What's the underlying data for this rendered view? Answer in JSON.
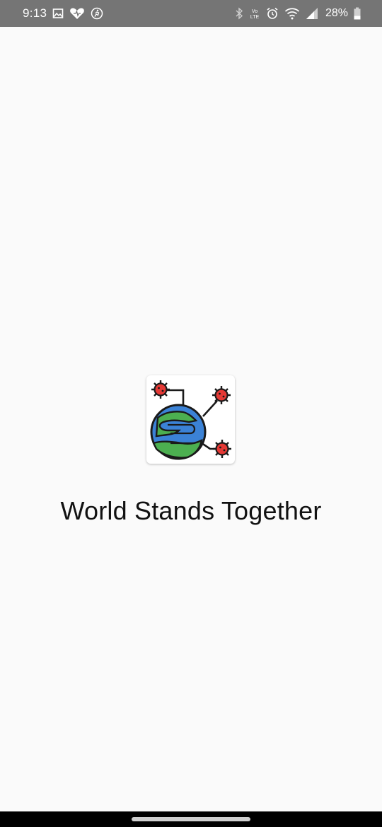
{
  "status_bar": {
    "time": "9:13",
    "battery_percent": "28%",
    "left_icons": [
      "gallery-icon",
      "health-heart-icon",
      "fitness-icon"
    ],
    "right_icons": [
      "bluetooth-icon",
      "volte-icon",
      "alarm-icon",
      "wifi-icon",
      "signal-icon",
      "battery-icon"
    ],
    "volte_text": "Vo LTE"
  },
  "splash": {
    "app_icon": "globe-virus-icon",
    "title": "World Stands Together"
  },
  "colors": {
    "status_bar_bg": "#757575",
    "background": "#fafafa",
    "globe_ocean": "#3b82d6",
    "globe_land": "#4caf50",
    "virus": "#e53935",
    "nav_bar_bg": "#000000"
  }
}
